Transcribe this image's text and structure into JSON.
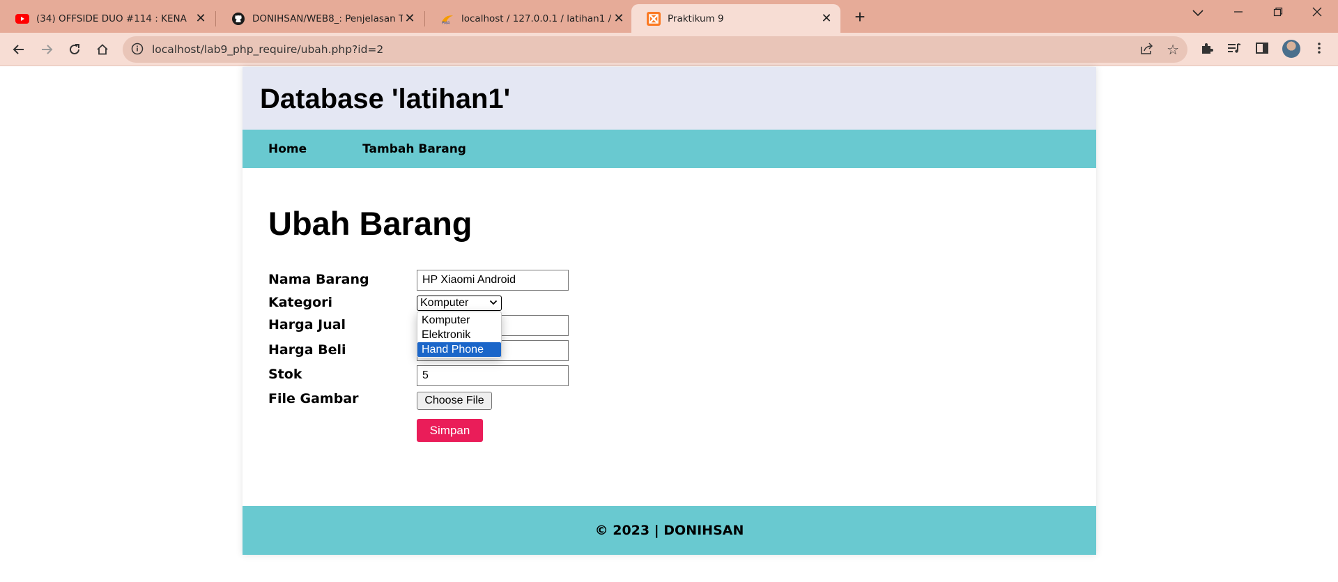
{
  "browser": {
    "tabs": [
      {
        "title": "(34) OFFSIDE DUO #114 : KENA",
        "icon": "youtube-icon"
      },
      {
        "title": "DONIHSAN/WEB8_: Penjelasan T",
        "icon": "github-icon"
      },
      {
        "title": "localhost / 127.0.0.1 / latihan1 /",
        "icon": "phpmyadmin-icon"
      },
      {
        "title": "Praktikum 9",
        "icon": "xampp-icon"
      }
    ],
    "active_tab": 3,
    "url": "localhost/lab9_php_require/ubah.php?id=2"
  },
  "page": {
    "header_title": "Database 'latihan1'",
    "nav": {
      "home": "Home",
      "tambah": "Tambah Barang"
    },
    "heading": "Ubah Barang",
    "form": {
      "nama_label": "Nama Barang",
      "nama_value": "HP Xiaomi Android",
      "kategori_label": "Kategori",
      "kategori_value": "Komputer",
      "kategori_options": [
        "Komputer",
        "Elektronik",
        "Hand Phone"
      ],
      "kategori_highlighted": "Hand Phone",
      "harga_jual_label": "Harga Jual",
      "harga_beli_label": "Harga Beli",
      "stok_label": "Stok",
      "stok_value": "5",
      "file_label": "File Gambar",
      "file_button": "Choose File",
      "submit_label": "Simpan"
    },
    "footer": "© 2023 | DONIHSAN"
  },
  "colors": {
    "tabbar": "#e6ab98",
    "toolbar": "#f7ddd4",
    "header_bg": "#e4e7f3",
    "nav_bg": "#69c9d0",
    "footer_bg": "#69c9d0",
    "submit_bg": "#ea1d59",
    "dropdown_highlight": "#1b66c9"
  }
}
